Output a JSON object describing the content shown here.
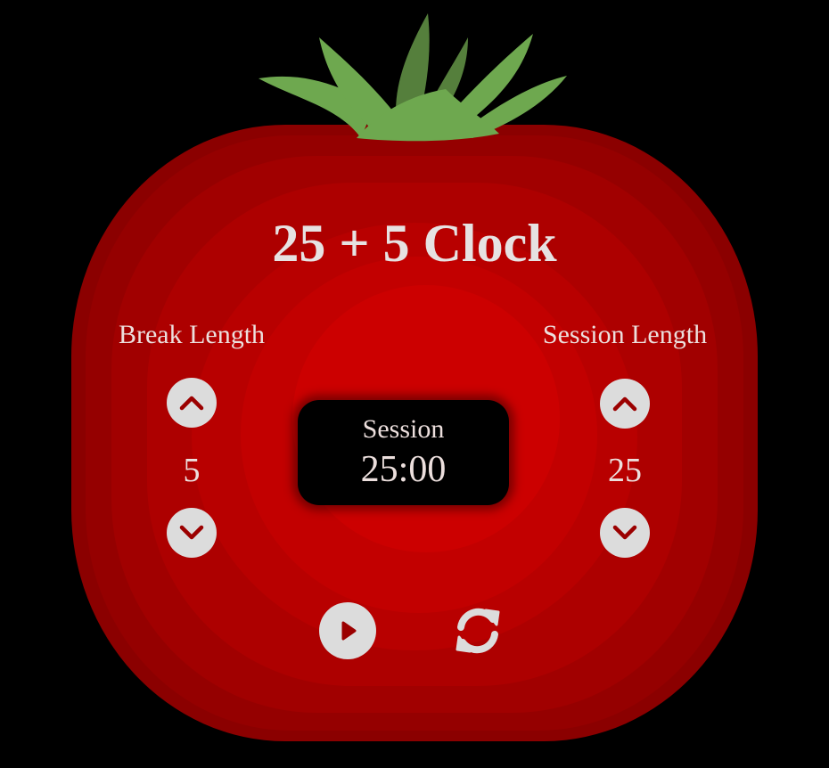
{
  "app": {
    "title": "25 + 5 Clock"
  },
  "break": {
    "label": "Break Length",
    "value": "5",
    "increment_icon": "chevron-up-icon",
    "decrement_icon": "chevron-down-icon"
  },
  "session": {
    "label": "Session Length",
    "value": "25",
    "increment_icon": "chevron-up-icon",
    "decrement_icon": "chevron-down-icon"
  },
  "timer": {
    "label": "Session",
    "time_left": "25:00"
  },
  "controls": {
    "start_stop_icon": "play-icon",
    "reset_icon": "refresh-icon"
  },
  "colors": {
    "background": "#000000",
    "tomato_outer": "#8b0000",
    "tomato_inner": "#cc0000",
    "stem": "#6ea84f",
    "text": "#ecdfdd",
    "button": "#dcdcdc",
    "icon": "#9b0000"
  }
}
